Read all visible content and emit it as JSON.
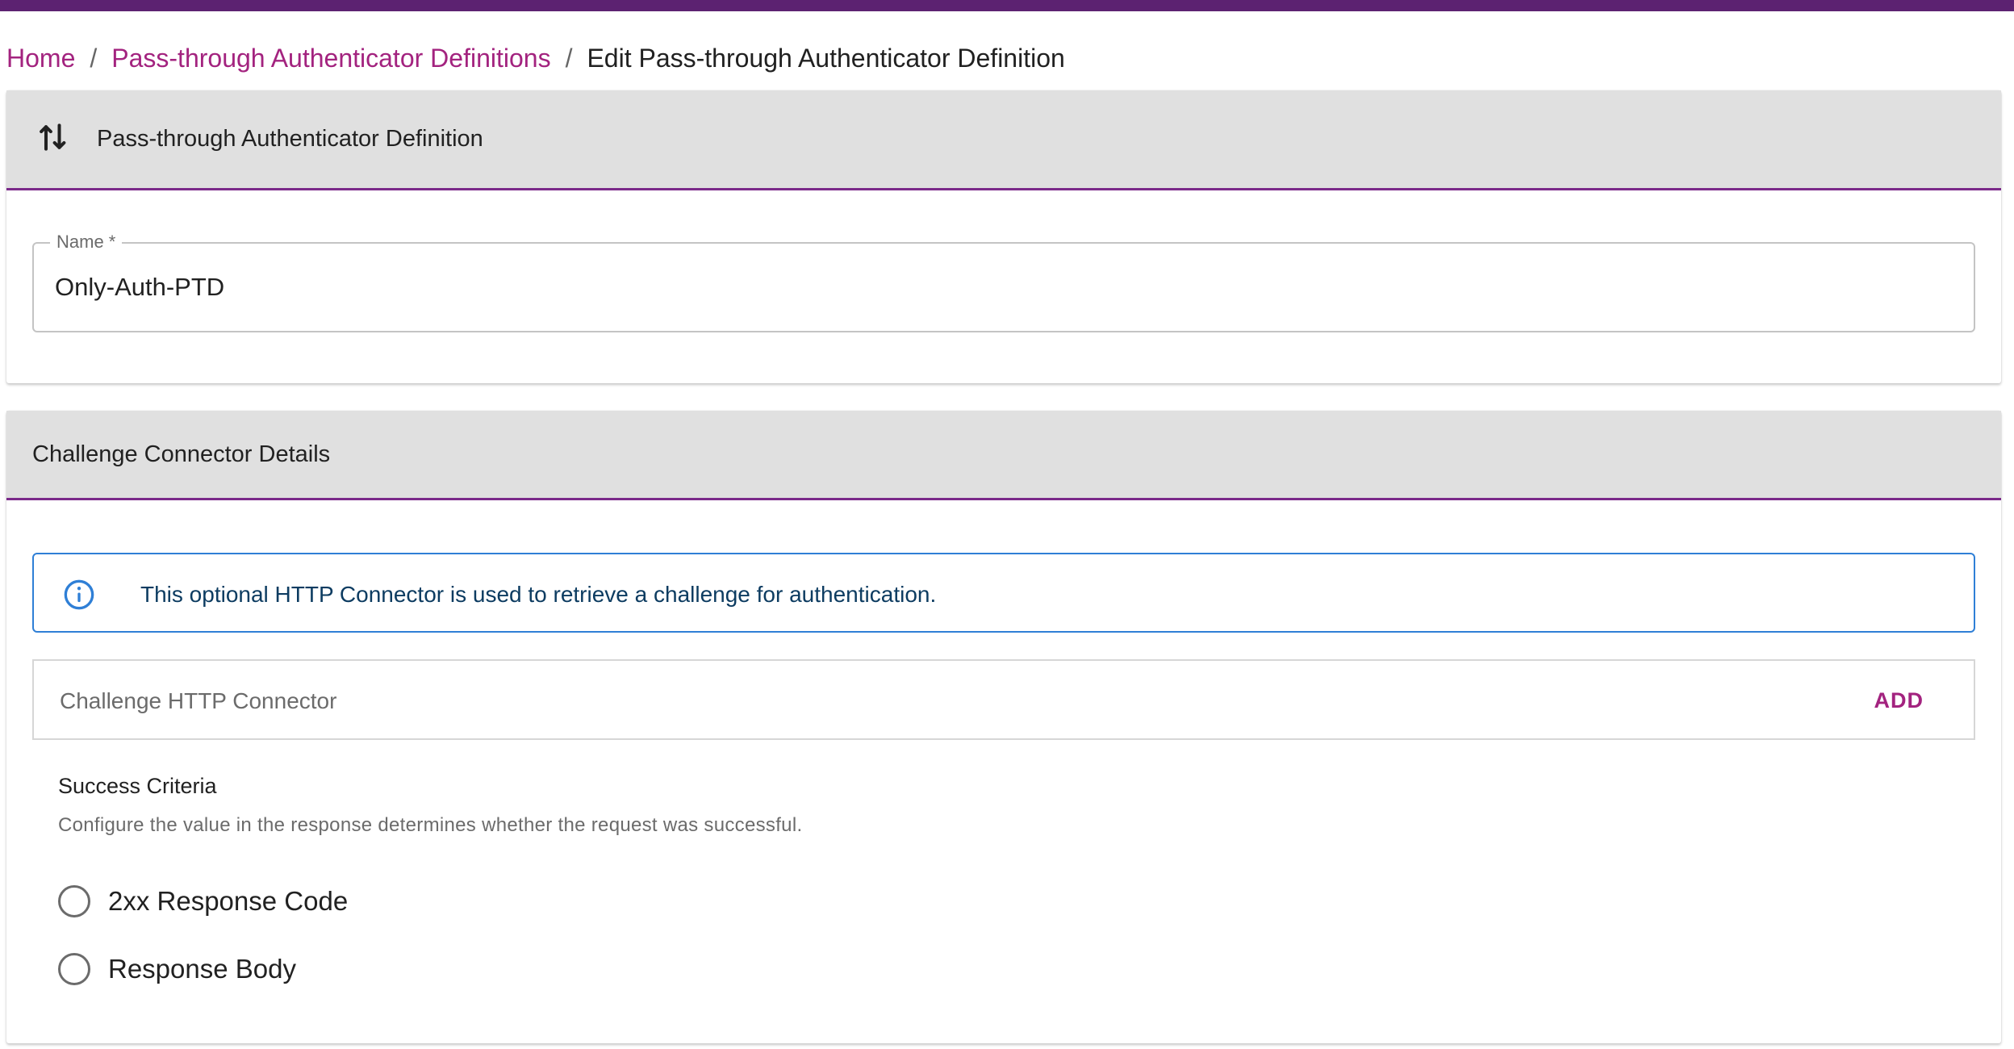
{
  "breadcrumb": {
    "home": "Home",
    "parent": "Pass-through Authenticator Definitions",
    "separator": "/",
    "current": "Edit Pass-through Authenticator Definition"
  },
  "definition_card": {
    "title": "Pass-through Authenticator Definition",
    "icon": "swap-vertical-icon",
    "name_field": {
      "label": "Name *",
      "value": "Only-Auth-PTD"
    }
  },
  "challenge_card": {
    "title": "Challenge Connector Details",
    "alert": {
      "icon": "info-icon",
      "text": "This optional HTTP Connector is used to retrieve a challenge for authentication."
    },
    "connector": {
      "label": "Challenge HTTP Connector",
      "add_label": "ADD"
    },
    "success_criteria": {
      "title": "Success Criteria",
      "description": "Configure the value in the response determines whether the request was successful.",
      "options": [
        {
          "label": "2xx Response Code",
          "selected": false
        },
        {
          "label": "Response Body",
          "selected": false
        }
      ]
    }
  },
  "colors": {
    "brand": "#5c2271",
    "accent": "#a3237f",
    "header_underline": "#7b2a8a",
    "info_border": "#2f7fd6",
    "card_header_bg": "#e0e0e0"
  }
}
